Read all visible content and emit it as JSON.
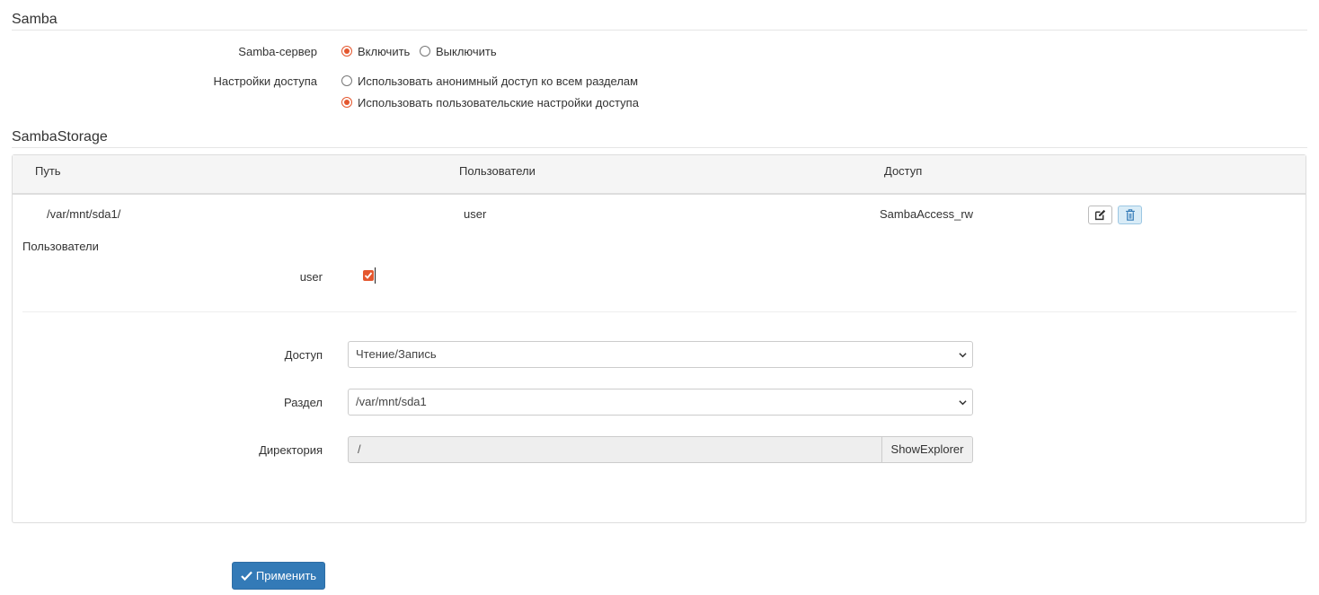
{
  "samba": {
    "title": "Samba",
    "server_label": "Samba-сервер",
    "server_options": [
      "Включить",
      "Выключить"
    ],
    "server_selected": "Включить",
    "access_label": "Настройки доступа",
    "access_options": [
      "Использовать анонимный доступ ко всем разделам",
      "Использовать пользовательские настройки доступа"
    ],
    "access_selected": "Использовать пользовательские настройки доступа"
  },
  "storage": {
    "title": "SambaStorage",
    "columns": [
      "Путь",
      "Пользователи",
      "Доступ"
    ],
    "rows": [
      {
        "path": "/var/mnt/sda1/",
        "users": "user",
        "access": "SambaAccess_rw"
      }
    ],
    "edit_icon": "edit-icon",
    "delete_icon": "trash-icon",
    "editor": {
      "users_heading": "Пользователи",
      "users": [
        {
          "name": "user",
          "checked": true
        }
      ],
      "access_label": "Доступ",
      "access_value": "Чтение/Запись",
      "partition_label": "Раздел",
      "partition_value": "/var/mnt/sda1",
      "directory_label": "Директория",
      "directory_value": "/",
      "explorer_button": "ShowExplorer"
    }
  },
  "apply_button": "Применить",
  "colors": {
    "accent": "#e4572e",
    "primary": "#337ab7"
  }
}
